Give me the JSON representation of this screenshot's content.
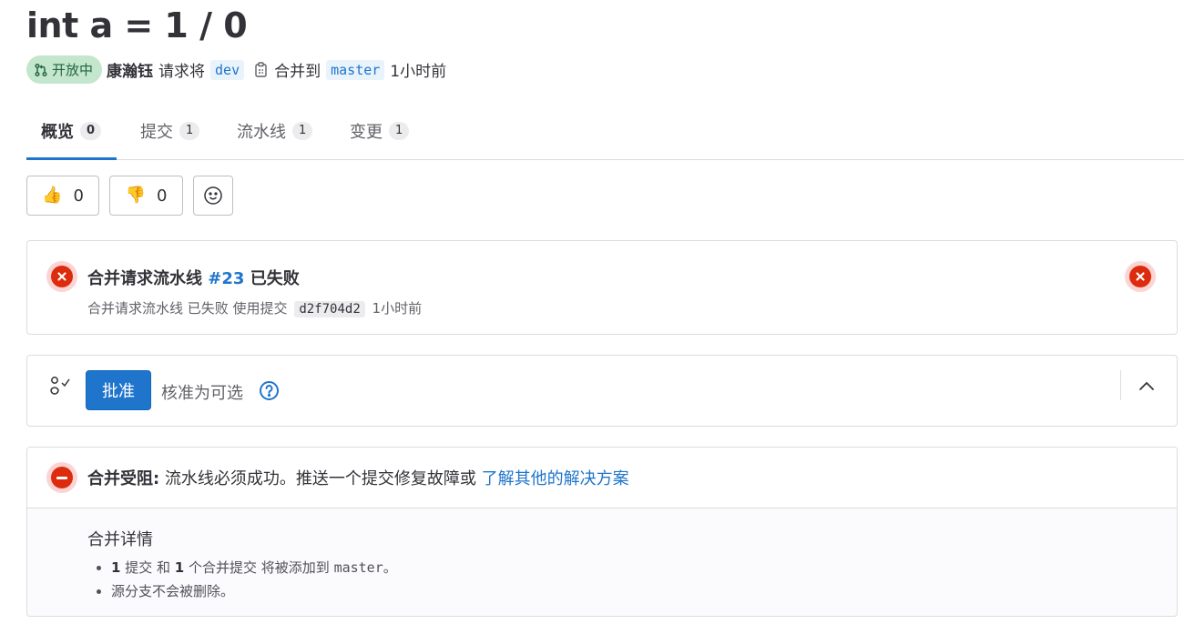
{
  "mr": {
    "title": "int a = 1 / 0",
    "status": "开放中",
    "author": "康瀚钰",
    "request_text": "请求将",
    "source_branch": "dev",
    "merge_into_text": "合并到",
    "target_branch": "master",
    "time_ago": "1小时前"
  },
  "tabs": [
    {
      "label": "概览",
      "count": "0"
    },
    {
      "label": "提交",
      "count": "1"
    },
    {
      "label": "流水线",
      "count": "1"
    },
    {
      "label": "变更",
      "count": "1"
    }
  ],
  "reactions": {
    "thumbs_up": {
      "emoji": "👍",
      "count": "0"
    },
    "thumbs_down": {
      "emoji": "👎",
      "count": "0"
    }
  },
  "pipeline": {
    "title_prefix": "合并请求流水线",
    "id_link": "#23",
    "title_suffix": "已失败",
    "sub_prefix": "合并请求流水线 已失败 使用提交",
    "commit_sha": "d2f704d2",
    "sub_time": "1小时前"
  },
  "approval": {
    "button_label": "批准",
    "optional_text": "核准为可选"
  },
  "merge": {
    "blocked_label": "合并受阻:",
    "blocked_text": "流水线必须成功。推送一个提交修复故障或",
    "learn_more_link": "了解其他的解决方案",
    "details_title": "合并详情",
    "detail1": {
      "commit_count": "1",
      "commit_word": "提交 和",
      "merge_count": "1",
      "merge_word": "个合并提交 将被添加到",
      "branch": "master",
      "end": "。"
    },
    "detail2": "源分支不会被删除。"
  },
  "colors": {
    "accent": "#1f75cb",
    "success_badge_bg": "#c3e6cd",
    "danger": "#dd2b0e"
  }
}
